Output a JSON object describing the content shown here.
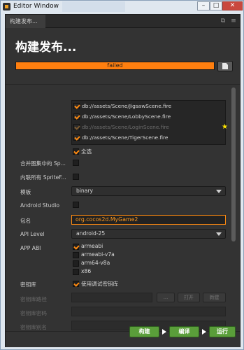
{
  "window": {
    "title": "Editor Window"
  },
  "tab": {
    "label": "构建发布..."
  },
  "page": {
    "heading": "构建发布..."
  },
  "progress": {
    "status_text": "failed",
    "fraction": 1.0
  },
  "scenes": {
    "items": [
      {
        "path": "db://assets/Scene/JigsawScene.fire",
        "checked": true,
        "disabled": false
      },
      {
        "path": "db://assets/Scene/LobbyScene.fire",
        "checked": true,
        "disabled": false
      },
      {
        "path": "db://assets/Scene/LoginScene.fire",
        "checked": true,
        "disabled": true
      },
      {
        "path": "db://assets/Scene/TigerScene.fire",
        "checked": true,
        "disabled": false
      }
    ],
    "select_all_label": "全选"
  },
  "form": {
    "merge_atlas_label": "合并图集中的 Sp...",
    "inline_sprite_label": "内联所有 SpriteF...",
    "template_label": "模板",
    "template_value": "binary",
    "android_studio_label": "Android Studio",
    "package_label": "包名",
    "package_value": "org.cocos2d.MyGame2",
    "api_level_label": "API Level",
    "api_level_value": "android-25",
    "app_abi_label": "APP ABI",
    "abi_options": [
      {
        "label": "armeabi",
        "checked": true
      },
      {
        "label": "armeabi-v7a",
        "checked": false
      },
      {
        "label": "arm64-v8a",
        "checked": false
      },
      {
        "label": "x86",
        "checked": false
      }
    ],
    "keystore_label": "密钥库",
    "use_debug_keystore_label": "使用调试密钥库",
    "keystore_path_label": "密钥库路径",
    "keystore_password_label": "密钥库密码",
    "keystore_alias_label": "密钥库别名",
    "browse_label": "...",
    "open_label": "打开",
    "new_label": "新建"
  },
  "footer": {
    "build_label": "构建",
    "compile_label": "编译",
    "run_label": "运行"
  },
  "colors": {
    "accent": "#ff7f0f",
    "panel_bg": "#333333",
    "button_green": "#5a9e3a"
  }
}
